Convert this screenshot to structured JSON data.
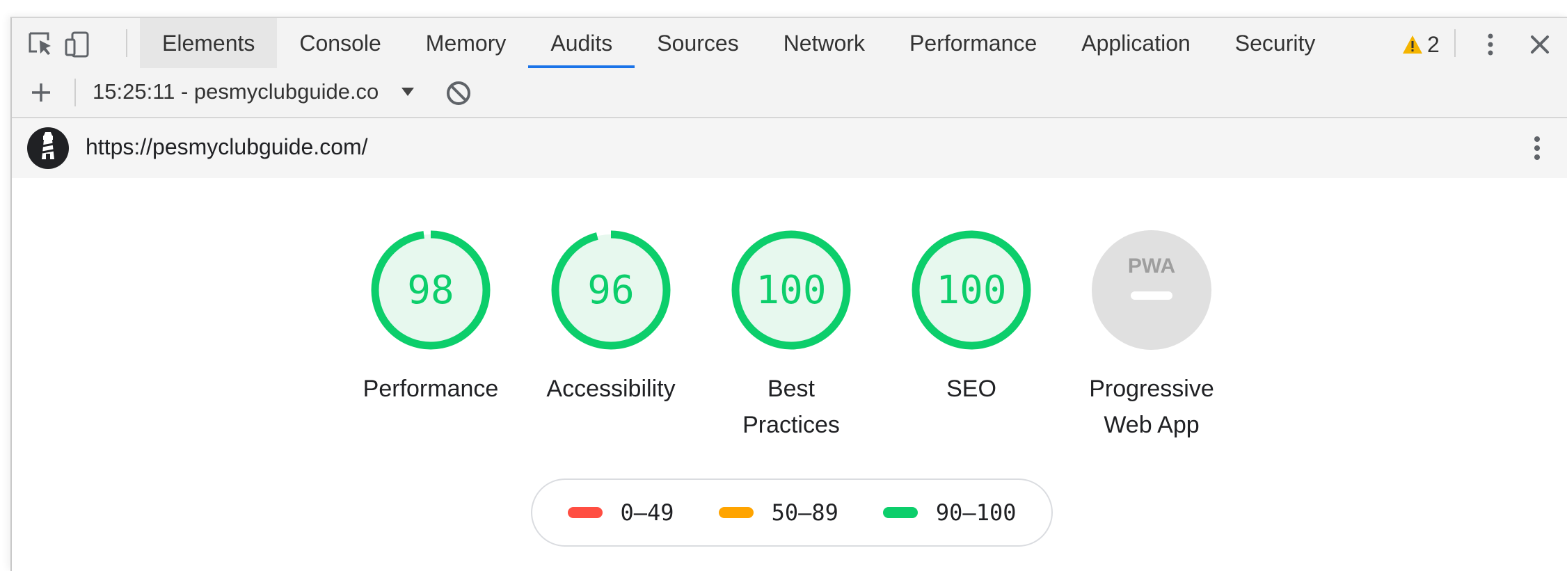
{
  "toolbar": {
    "tabs": [
      "Elements",
      "Console",
      "Memory",
      "Audits",
      "Sources",
      "Network",
      "Performance",
      "Application",
      "Security"
    ],
    "active_tab": "Audits",
    "warning_count": "2"
  },
  "subbar": {
    "report_label": "15:25:11 - pesmyclubguide.co"
  },
  "urlbar": {
    "url": "https://pesmyclubguide.com/"
  },
  "categories": [
    {
      "label": "Performance",
      "score": 98,
      "color": "#0cce6b"
    },
    {
      "label": "Accessibility",
      "score": 96,
      "color": "#0cce6b"
    },
    {
      "label": "Best Practices",
      "score": 100,
      "color": "#0cce6b"
    },
    {
      "label": "SEO",
      "score": 100,
      "color": "#0cce6b"
    },
    {
      "label": "Progressive Web App",
      "badge": "PWA",
      "score": null,
      "color": "#e0e0e0"
    }
  ],
  "legend": [
    {
      "range": "0–49",
      "color": "#ff4e42"
    },
    {
      "range": "50–89",
      "color": "#ffa400"
    },
    {
      "range": "90–100",
      "color": "#0cce6b"
    }
  ]
}
